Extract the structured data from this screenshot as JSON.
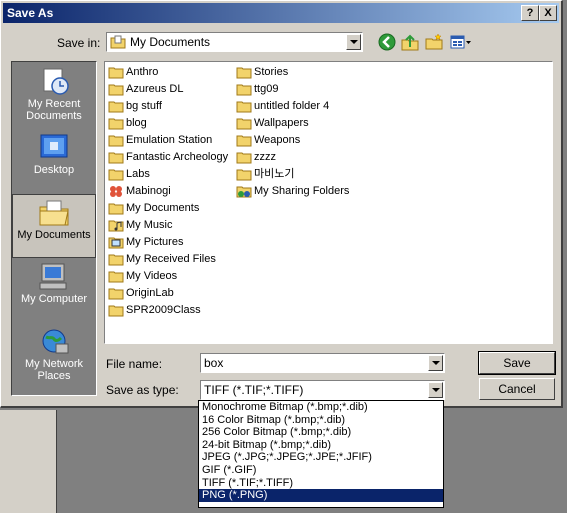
{
  "dialog": {
    "title": "Save As",
    "help_label": "?",
    "close_label": "X"
  },
  "toolbar": {
    "save_in_label": "Save in:",
    "save_in_value": "My Documents",
    "icons": [
      "back-icon",
      "up-folder-icon",
      "new-folder-icon",
      "views-menu-icon"
    ]
  },
  "places": [
    {
      "label": "My Recent Documents",
      "icon": "recent-documents-icon",
      "selected": false
    },
    {
      "label": "Desktop",
      "icon": "desktop-icon",
      "selected": false
    },
    {
      "label": "My Documents",
      "icon": "my-documents-icon",
      "selected": true
    },
    {
      "label": "My Computer",
      "icon": "my-computer-icon",
      "selected": false
    },
    {
      "label": "My Network Places",
      "icon": "network-places-icon",
      "selected": false
    }
  ],
  "files": {
    "column1": [
      {
        "name": "Anthro",
        "icon": "folder-icon"
      },
      {
        "name": "Azureus DL",
        "icon": "folder-icon"
      },
      {
        "name": "bg stuff",
        "icon": "folder-icon"
      },
      {
        "name": "blog",
        "icon": "folder-icon"
      },
      {
        "name": "Emulation Station",
        "icon": "folder-icon"
      },
      {
        "name": "Fantastic Archeology",
        "icon": "folder-icon"
      },
      {
        "name": "Labs",
        "icon": "folder-icon"
      },
      {
        "name": "Mabinogi",
        "icon": "mabinogi-icon"
      },
      {
        "name": "My Documents",
        "icon": "folder-icon"
      },
      {
        "name": "My Music",
        "icon": "music-folder-icon"
      },
      {
        "name": "My Pictures",
        "icon": "pictures-folder-icon"
      },
      {
        "name": "My Received Files",
        "icon": "folder-icon"
      },
      {
        "name": "My Videos",
        "icon": "folder-icon"
      },
      {
        "name": "OriginLab",
        "icon": "folder-icon"
      },
      {
        "name": "SPR2009Class",
        "icon": "folder-icon"
      }
    ],
    "column2": [
      {
        "name": "Stories",
        "icon": "folder-icon"
      },
      {
        "name": "ttg09",
        "icon": "folder-icon"
      },
      {
        "name": "untitled folder 4",
        "icon": "folder-icon"
      },
      {
        "name": "Wallpapers",
        "icon": "folder-icon"
      },
      {
        "name": "Weapons",
        "icon": "folder-icon"
      },
      {
        "name": "zzzz",
        "icon": "folder-icon"
      },
      {
        "name": "마비노기",
        "icon": "folder-icon"
      },
      {
        "name": "My Sharing Folders",
        "icon": "sharing-folder-icon"
      }
    ]
  },
  "form": {
    "file_name_label": "File name:",
    "file_name_value": "box",
    "save_type_label": "Save as type:",
    "save_type_value": "TIFF (*.TIF;*.TIFF)"
  },
  "buttons": {
    "save": "Save",
    "cancel": "Cancel"
  },
  "type_options": [
    "Monochrome Bitmap (*.bmp;*.dib)",
    "16 Color Bitmap (*.bmp;*.dib)",
    "256 Color Bitmap (*.bmp;*.dib)",
    "24-bit Bitmap (*.bmp;*.dib)",
    "JPEG (*.JPG;*.JPEG;*.JPE;*.JFIF)",
    "GIF (*.GIF)",
    "TIFF (*.TIF;*.TIFF)",
    "PNG (*.PNG)"
  ],
  "type_selected_index": 7,
  "colors": {
    "titlebar": "#0a246a",
    "selection": "#0a246a",
    "dialog_face": "#d4d0c8"
  }
}
